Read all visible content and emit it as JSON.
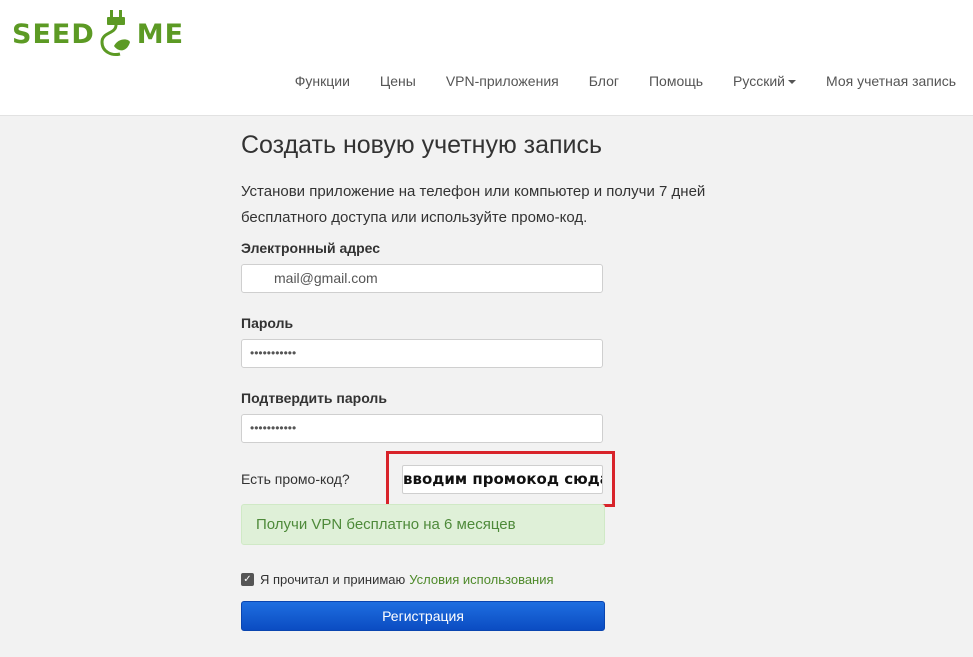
{
  "logo": {
    "left": "SEED",
    "right": "ME"
  },
  "nav": {
    "items": [
      "Функции",
      "Цены",
      "VPN-приложения",
      "Блог",
      "Помощь"
    ],
    "language": "Русский",
    "account": "Моя учетная запись"
  },
  "form": {
    "title": "Создать новую учетную запись",
    "lead": "Установи приложение на телефон или компьютер и получи 7 дней бесплатного доступа или используйте промо-код.",
    "email_label": "Электронный адрес",
    "email_value": "mail@gmail.com",
    "password_label": "Пароль",
    "password_value": "•••••••••••",
    "confirm_label": "Подтвердить пароль",
    "confirm_value": "•••••••••••",
    "promo_label": "Есть промо-код?",
    "promo_value": "вводим промокод сюда",
    "promo_info": "Получи VPN бесплатно на 6 месяцев",
    "terms_text": "Я прочитал и принимаю",
    "terms_link": "Условия использования",
    "terms_checked": true,
    "register_label": "Регистрация"
  },
  "colors": {
    "brand": "#5c9a24",
    "highlight": "#d8232a",
    "button": "#0b4cc2"
  }
}
